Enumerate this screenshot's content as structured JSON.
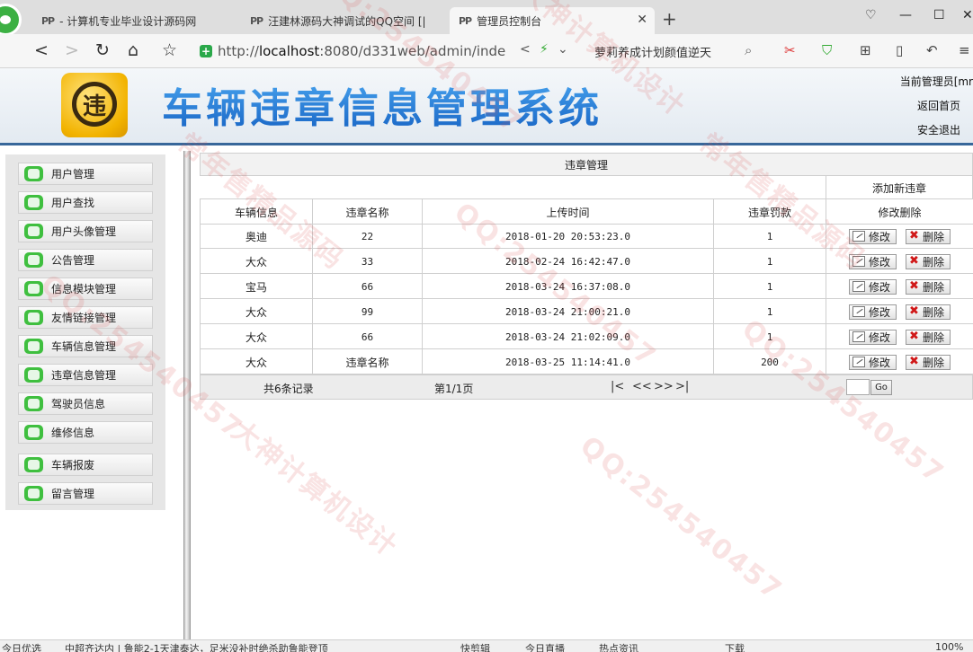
{
  "browser": {
    "tabs": [
      {
        "label": "- 计算机专业毕业设计源码网"
      },
      {
        "label": "汪建林源码大神调试的QQ空间 [|"
      },
      {
        "label": "管理员控制台"
      }
    ],
    "url_prefix": "http://",
    "url_host": "localhost",
    "url_rest": ":8080/d331web/admin/index",
    "search_hint": "萝莉养成计划颜值逆天"
  },
  "header": {
    "logo_char": "违",
    "title": "车辆违章信息管理系统",
    "current_admin": "当前管理员[mr",
    "home_link": "返回首页",
    "logout_link": "安全退出"
  },
  "sidebar": {
    "items": [
      {
        "label": "用户管理"
      },
      {
        "label": "用户查找"
      },
      {
        "label": "用户头像管理"
      },
      {
        "label": "公告管理"
      },
      {
        "label": "信息模块管理"
      },
      {
        "label": "友情链接管理"
      },
      {
        "label": "车辆信息管理"
      },
      {
        "label": "违章信息管理"
      },
      {
        "label": "驾驶员信息"
      },
      {
        "label": "维修信息"
      },
      {
        "label": "车辆报废"
      },
      {
        "label": "留言管理"
      }
    ]
  },
  "panel": {
    "title": "违章管理",
    "add_link": "添加新违章",
    "columns": [
      "车辆信息",
      "违章名称",
      "上传时间",
      "违章罚款",
      "修改删除"
    ],
    "edit_label": "修改",
    "delete_label": "删除",
    "rows": [
      {
        "vehicle": "奥迪",
        "name": "22",
        "time": "2018-01-20 20:53:23.0",
        "fine": "1"
      },
      {
        "vehicle": "大众",
        "name": "33",
        "time": "2018-02-24 16:42:47.0",
        "fine": "1"
      },
      {
        "vehicle": "宝马",
        "name": "66",
        "time": "2018-03-24 16:37:08.0",
        "fine": "1"
      },
      {
        "vehicle": "大众",
        "name": "99",
        "time": "2018-03-24 21:00:21.0",
        "fine": "1"
      },
      {
        "vehicle": "大众",
        "name": "66",
        "time": "2018-03-24 21:02:09.0",
        "fine": "1"
      },
      {
        "vehicle": "大众",
        "name": "违章名称",
        "time": "2018-03-25 11:14:41.0",
        "fine": "200"
      }
    ],
    "pager": {
      "total": "共6条记录",
      "page": "第1/1页",
      "first": "|<",
      "prev": "<<",
      "next": ">>",
      "last": ">|",
      "go": "Go"
    }
  },
  "statusbar": {
    "left": "今日优选",
    "news": "中超齐达内 | 鲁能2-1天津泰达，足米没补时绝杀助鲁能登顶",
    "items": [
      "快剪辑",
      "今日直播",
      "热点资讯",
      "下载",
      "100%"
    ]
  },
  "watermark": {
    "texts": [
      "QQ:254540457",
      "大神计算机设计",
      "常年售精品源码"
    ]
  }
}
